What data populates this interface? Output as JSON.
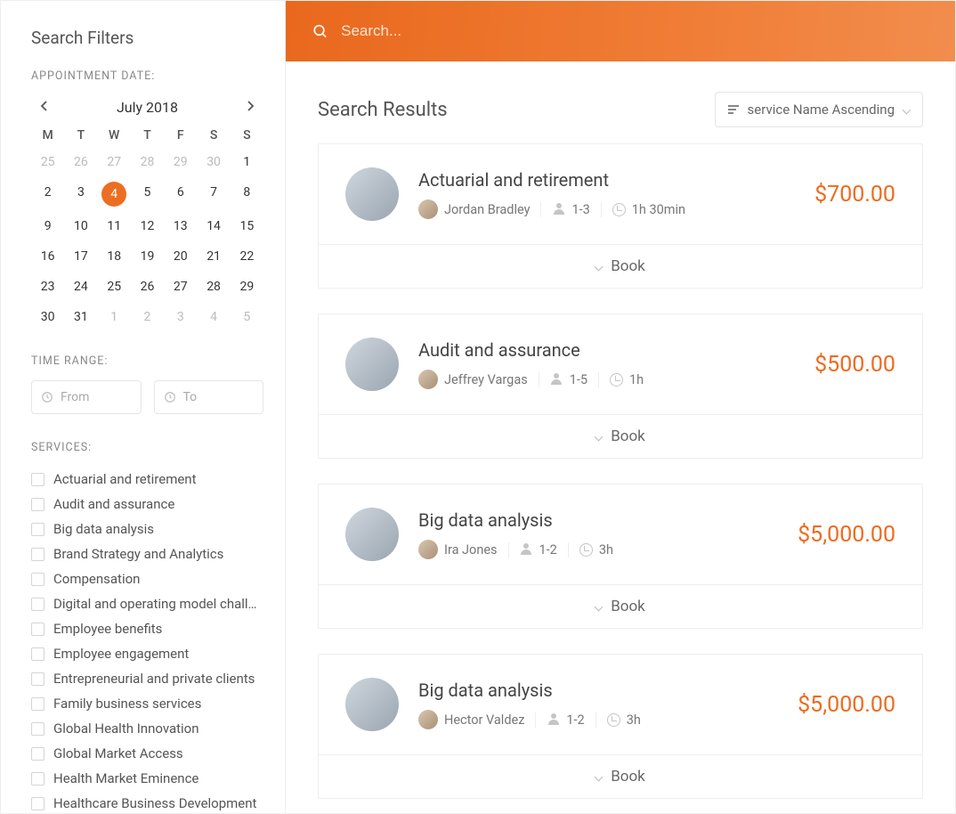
{
  "sidebar": {
    "title": "Search Filters",
    "appointment_label": "APPOINTMENT DATE:",
    "time_range_label": "TIME RANGE:",
    "services_label": "SERVICES:",
    "time_from_placeholder": "From",
    "time_to_placeholder": "To"
  },
  "calendar": {
    "month_label": "July 2018",
    "dow": [
      "M",
      "T",
      "W",
      "T",
      "F",
      "S",
      "S"
    ],
    "weeks": [
      [
        {
          "d": 25,
          "muted": true
        },
        {
          "d": 26,
          "muted": true
        },
        {
          "d": 27,
          "muted": true
        },
        {
          "d": 28,
          "muted": true
        },
        {
          "d": 29,
          "muted": true
        },
        {
          "d": 30,
          "muted": true
        },
        {
          "d": 1
        }
      ],
      [
        {
          "d": 2
        },
        {
          "d": 3
        },
        {
          "d": 4,
          "selected": true
        },
        {
          "d": 5
        },
        {
          "d": 6
        },
        {
          "d": 7
        },
        {
          "d": 8
        }
      ],
      [
        {
          "d": 9
        },
        {
          "d": 10
        },
        {
          "d": 11
        },
        {
          "d": 12
        },
        {
          "d": 13
        },
        {
          "d": 14
        },
        {
          "d": 15
        }
      ],
      [
        {
          "d": 16
        },
        {
          "d": 17
        },
        {
          "d": 18
        },
        {
          "d": 19
        },
        {
          "d": 20
        },
        {
          "d": 21
        },
        {
          "d": 22
        }
      ],
      [
        {
          "d": 23
        },
        {
          "d": 24
        },
        {
          "d": 25
        },
        {
          "d": 26
        },
        {
          "d": 27
        },
        {
          "d": 28
        },
        {
          "d": 29
        }
      ],
      [
        {
          "d": 30
        },
        {
          "d": 31
        },
        {
          "d": 1,
          "muted": true
        },
        {
          "d": 2,
          "muted": true
        },
        {
          "d": 3,
          "muted": true
        },
        {
          "d": 4,
          "muted": true
        },
        {
          "d": 5,
          "muted": true
        }
      ]
    ]
  },
  "services": [
    "Actuarial and retirement",
    "Audit and assurance",
    "Big data analysis",
    "Brand Strategy and Analytics",
    "Compensation",
    "Digital and operating model challen…",
    "Employee benefits",
    "Employee engagement",
    "Entrepreneurial and private clients",
    "Family business services",
    "Global Health Innovation",
    "Global Market Access",
    "Health Market Eminence",
    "Healthcare Business Development"
  ],
  "search": {
    "placeholder": "Search..."
  },
  "results": {
    "title": "Search Results",
    "sort_label": "service Name Ascending",
    "book_label": "Book",
    "items": [
      {
        "title": "Actuarial and retirement",
        "provider": "Jordan Bradley",
        "capacity": "1-3",
        "duration": "1h 30min",
        "price": "$700.00"
      },
      {
        "title": "Audit and assurance",
        "provider": "Jeffrey Vargas",
        "capacity": "1-5",
        "duration": "1h",
        "price": "$500.00"
      },
      {
        "title": "Big data analysis",
        "provider": "Ira Jones",
        "capacity": "1-2",
        "duration": "3h",
        "price": "$5,000.00"
      },
      {
        "title": "Big data analysis",
        "provider": "Hector Valdez",
        "capacity": "1-2",
        "duration": "3h",
        "price": "$5,000.00"
      }
    ]
  }
}
